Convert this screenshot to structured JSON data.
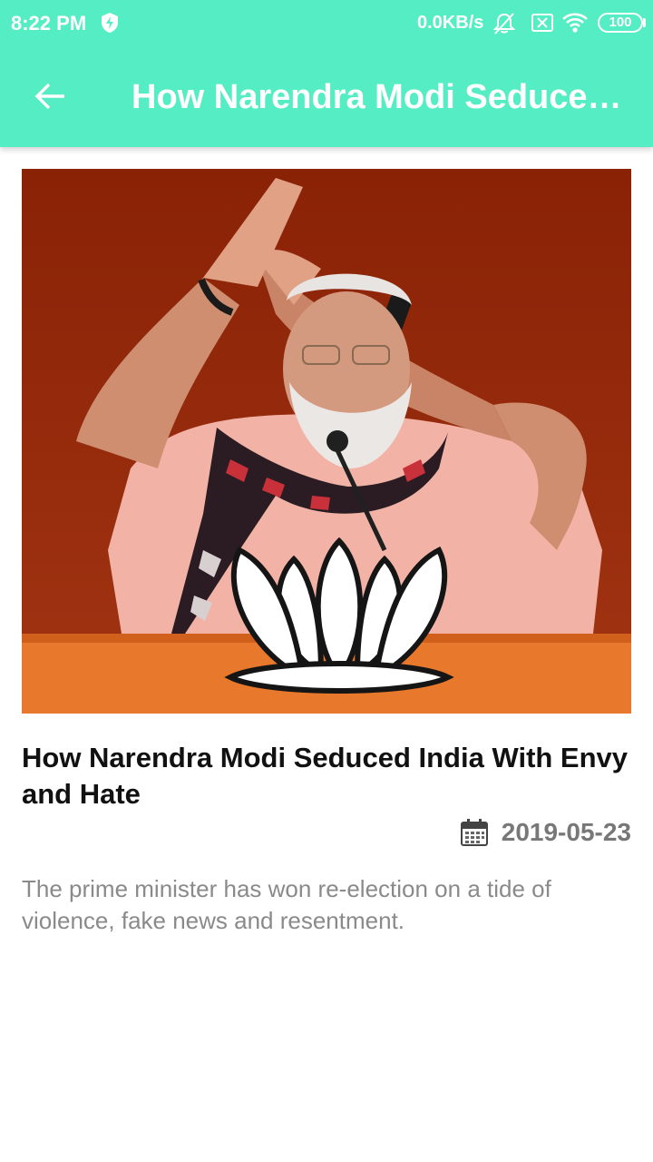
{
  "status_bar": {
    "time": "8:22 PM",
    "network_speed": "0.0KB/s",
    "battery": "100",
    "icons": [
      "shield-bolt-icon",
      "bell-off-icon",
      "sim-x-icon",
      "wifi-icon",
      "battery-icon"
    ]
  },
  "toolbar": {
    "back_icon": "arrow-left-icon",
    "title": "How Narendra Modi Seduced India With Envy and Hate"
  },
  "article": {
    "title": "How Narendra Modi Seduced India With Envy and Hate",
    "date_icon": "calendar-icon",
    "date": "2019-05-23",
    "summary": "The prime minister has won re-election on a tide of violence, fake news and resentment."
  },
  "colors": {
    "header": "#55edc3",
    "title_text": "#111111",
    "date_text": "#777777",
    "summary_text": "#8a8a8a"
  }
}
